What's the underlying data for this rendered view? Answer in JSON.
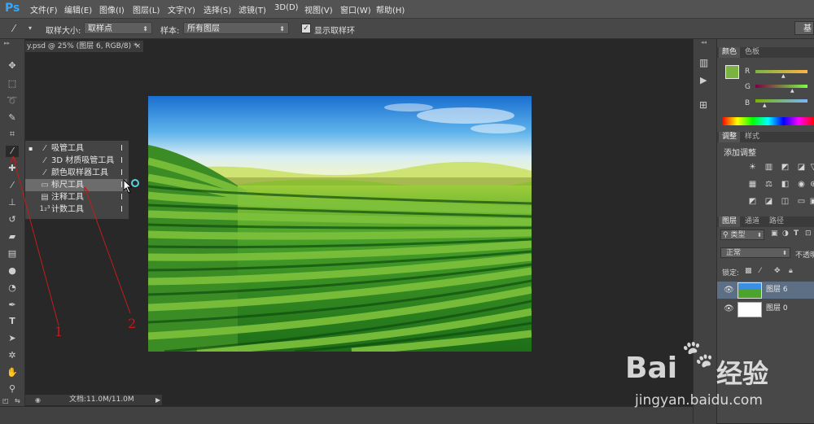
{
  "app": {
    "logo": "Ps"
  },
  "menu": [
    "文件(F)",
    "编辑(E)",
    "图像(I)",
    "图层(L)",
    "文字(Y)",
    "选择(S)",
    "滤镜(T)",
    "3D(D)",
    "视图(V)",
    "窗口(W)",
    "帮助(H)"
  ],
  "options": {
    "sample_size_label": "取样大小:",
    "sample_size_value": "取样点",
    "sample_label": "样本:",
    "sample_value": "所有图层",
    "show_ring_label": "显示取样环",
    "workspace_button": "基"
  },
  "document_tab": {
    "title": "y.psd @ 25% (图层 6, RGB/8) *",
    "close": "×"
  },
  "flyout": {
    "items": [
      {
        "label": "吸管工具",
        "key": "I",
        "icon": "eyedropper-icon",
        "checked": true
      },
      {
        "label": "3D 材质吸管工具",
        "key": "I",
        "icon": "3d-eyedropper-icon"
      },
      {
        "label": "颜色取样器工具",
        "key": "I",
        "icon": "color-sampler-icon"
      },
      {
        "label": "标尺工具",
        "key": "I",
        "icon": "ruler-icon",
        "selected": true
      },
      {
        "label": "注释工具",
        "key": "I",
        "icon": "note-icon"
      },
      {
        "label": "计数工具",
        "key": "I",
        "icon": "count-icon"
      }
    ],
    "checkmark": "▪"
  },
  "status": {
    "doc_info": "文档:11.0M/11.0M"
  },
  "color_panel": {
    "tabs": [
      "颜色",
      "色板"
    ],
    "channels": [
      "R",
      "G",
      "B"
    ],
    "fg_color": "#7bb342",
    "bg_color": "#ffffff"
  },
  "adjust_panel": {
    "tabs": [
      "调整",
      "样式"
    ],
    "title": "添加调整"
  },
  "layers_panel": {
    "tabs": [
      "图层",
      "通道",
      "路径"
    ],
    "kind_filter": "类型",
    "blend_mode": "正常",
    "opacity_label": "不透明",
    "lock_label": "锁定:",
    "layers": [
      {
        "name": "图层 6",
        "selected": true
      },
      {
        "name": "图层 0",
        "selected": false
      }
    ]
  },
  "annotations": [
    "1",
    "2"
  ],
  "watermark": {
    "brand": "Bai",
    "brand2": "经验",
    "url": "jingyan.baidu.com"
  },
  "colors": {
    "accent": "#31a8ff",
    "annotation": "#c21d1d",
    "panel": "#484848"
  }
}
